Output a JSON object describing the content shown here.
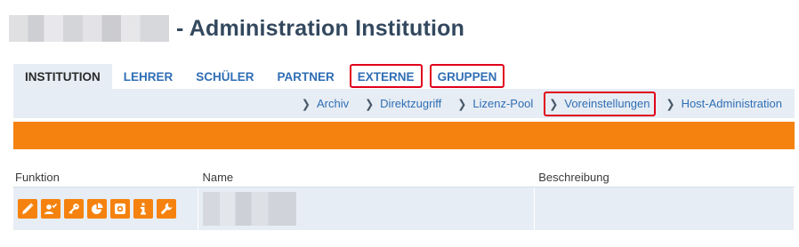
{
  "header": {
    "title": "- Administration Institution"
  },
  "tabs": [
    {
      "label": "INSTITUTION",
      "active": true,
      "highlighted": false
    },
    {
      "label": "LEHRER",
      "active": false,
      "highlighted": false
    },
    {
      "label": "SCHÜLER",
      "active": false,
      "highlighted": false
    },
    {
      "label": "PARTNER",
      "active": false,
      "highlighted": false
    },
    {
      "label": "EXTERNE",
      "active": false,
      "highlighted": true
    },
    {
      "label": "GRUPPEN",
      "active": false,
      "highlighted": true
    }
  ],
  "subnav": [
    {
      "label": "Archiv",
      "highlighted": false
    },
    {
      "label": "Direktzugriff",
      "highlighted": false
    },
    {
      "label": "Lizenz-Pool",
      "highlighted": false
    },
    {
      "label": "Voreinstellungen",
      "highlighted": true
    },
    {
      "label": "Host-Administration",
      "highlighted": false
    }
  ],
  "table": {
    "headers": {
      "function": "Funktion",
      "name": "Name",
      "description": "Beschreibung"
    },
    "row_icons": [
      "pencil-icon",
      "user-check-icon",
      "key-icon",
      "pie-chart-icon",
      "target-icon",
      "info-icon",
      "wrench-icon"
    ]
  },
  "colors": {
    "accent_orange": "#f5820e",
    "nav_bg": "#e7edf4",
    "link_blue": "#2f6eb5",
    "highlight_red": "#e0001b",
    "title_color": "#33485e"
  }
}
